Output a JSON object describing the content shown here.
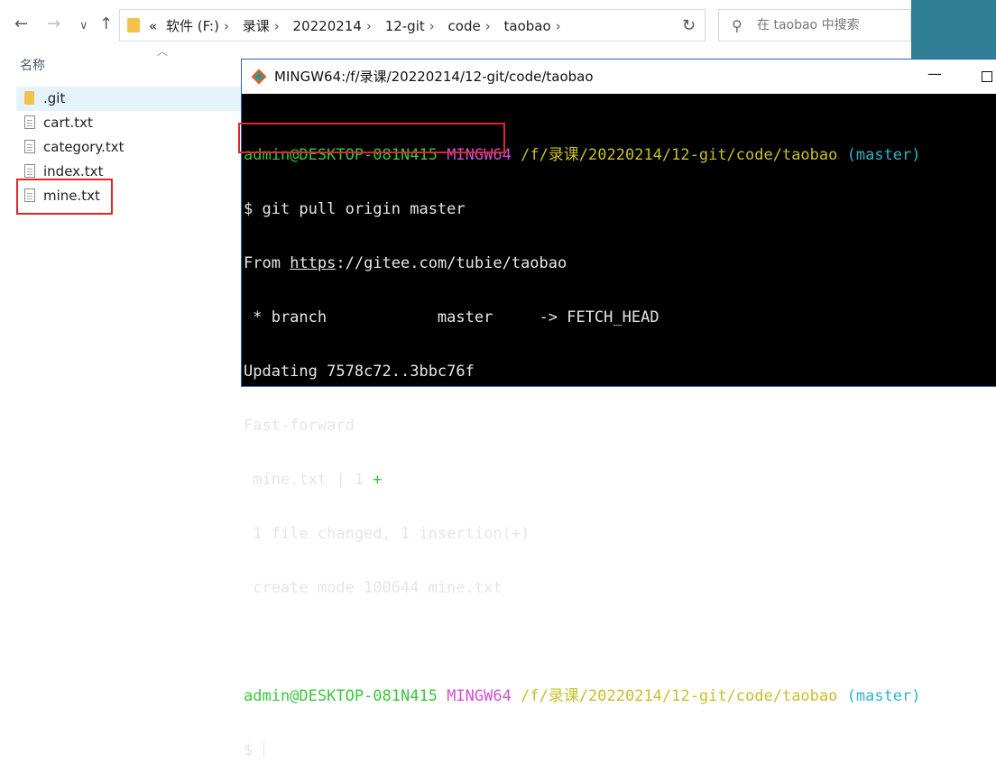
{
  "explorer": {
    "nav": {
      "back": "←",
      "forward": "→",
      "recent": "∨",
      "up": "↑"
    },
    "breadcrumbs": [
      "«",
      "软件 (F:)",
      "录课",
      "20220214",
      "12-git",
      "code",
      "taobao"
    ],
    "refresh_icon": "refresh-icon",
    "search_placeholder": "在 taobao 中搜索",
    "column_header": "名称",
    "files": [
      {
        "name": ".git",
        "type": "folder",
        "selected": true
      },
      {
        "name": "cart.txt",
        "type": "file"
      },
      {
        "name": "category.txt",
        "type": "file"
      },
      {
        "name": "index.txt",
        "type": "file"
      },
      {
        "name": "mine.txt",
        "type": "file",
        "highlighted": true
      }
    ],
    "colors": {
      "accent_strip": "#2f7f96",
      "highlight_border": "#e0262a",
      "folder": "#f3c24a"
    }
  },
  "terminal": {
    "title": "MINGW64:/f/录课/20220214/12-git/code/taobao",
    "prompt1": {
      "user": "admin@DESKTOP-081N415",
      "shell": "MINGW64",
      "path": "/f/录课/20220214/12-git/code/taobao",
      "branch": "(master)"
    },
    "command": "$ git pull origin master",
    "output": {
      "from_prefix": "From ",
      "from_scheme": "https",
      "from_rest": "://gitee.com/tubie/taobao",
      "branch_line": " * branch            master     -> FETCH_HEAD",
      "updating": "Updating 7578c72..3bbc76f",
      "fast_forward": "Fast-forward",
      "diffstat_file": " mine.txt | 1 ",
      "diffstat_plus": "+",
      "summary": " 1 file changed, 1 insertion(+)",
      "create": " create mode 100644 mine.txt"
    },
    "prompt2": {
      "user": "admin@DESKTOP-081N415",
      "shell": "MINGW64",
      "path": "/f/录课/20220214/12-git/code/taobao",
      "branch": "(master)"
    },
    "final_prompt": "$ ",
    "colors": {
      "green": "#3cc63c",
      "magenta": "#d14fd1",
      "yellow": "#c8bf2a",
      "cyan": "#2bb6c9"
    }
  }
}
